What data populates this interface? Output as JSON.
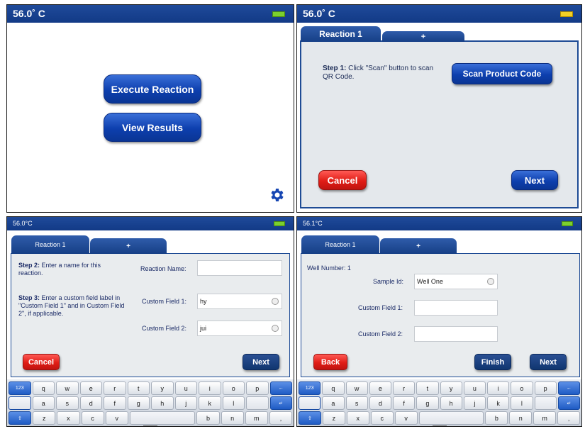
{
  "colors": {
    "title_bar": "#1a4491",
    "button_blue": "#0d3fae",
    "button_red": "#e01d16",
    "panel_bg": "#e4e8ec",
    "battery_green": "#7bd02e",
    "battery_yellow": "#f2cf26"
  },
  "screen1": {
    "temperature": "56.0˚ C",
    "execute_label": "Execute Reaction",
    "view_label": "View Results",
    "settings_icon": "gear-icon"
  },
  "screen2": {
    "temperature": "56.0˚ C",
    "tab_reaction": "Reaction 1",
    "tab_add": "+",
    "step_label": "Step 1:",
    "step_text": " Click \"Scan\" button to scan QR Code.",
    "scan_label": "Scan Product Code",
    "cancel_label": "Cancel",
    "next_label": "Next"
  },
  "screen3": {
    "temperature": "56.0°C",
    "tab_reaction": "Reaction 1",
    "tab_add": "+",
    "step2_label": "Step 2:",
    "step2_text": " Enter a name for this reaction.",
    "step3_label": "Step 3:",
    "step3_text": " Enter a custom field label in \"Custom Field 1\" and in Custom Field 2\", if applicable.",
    "reaction_name_label": "Reaction Name:",
    "reaction_name_value": "",
    "custom1_label": "Custom Field 1:",
    "custom1_value": "hy",
    "custom2_label": "Custom Field 2:",
    "custom2_value": "jui",
    "cancel_label": "Cancel",
    "next_label": "Next"
  },
  "screen4": {
    "temperature": "56.1°C",
    "tab_reaction": "Reaction 1",
    "tab_add": "+",
    "well_number": "Well Number: 1",
    "sample_label": "Sample Id:",
    "sample_value": "Well One",
    "custom1_label": "Custom Field 1:",
    "custom1_value": "",
    "custom2_label": "Custom Field 2:",
    "custom2_value": "",
    "back_label": "Back",
    "finish_label": "Finish",
    "next_label": "Next"
  },
  "keyboard": {
    "row1": [
      "123",
      "q",
      "w",
      "e",
      "r",
      "t",
      "y",
      "u",
      "i",
      "o",
      "p",
      "←"
    ],
    "row2": [
      "",
      "a",
      "s",
      "d",
      "f",
      "g",
      "h",
      "j",
      "k",
      "l",
      "",
      "↵"
    ],
    "row3": [
      "⇧",
      "z",
      "x",
      "c",
      "v",
      "",
      "b",
      "n",
      "m",
      ","
    ]
  }
}
